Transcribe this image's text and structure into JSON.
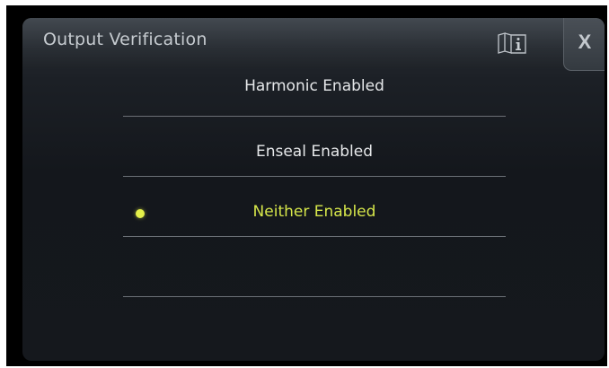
{
  "dialog": {
    "title": "Output Verification",
    "info_icon": "manual-info-icon",
    "close_label": "X"
  },
  "options": [
    {
      "label": "Harmonic Enabled",
      "selected": false
    },
    {
      "label": "Enseal Enabled",
      "selected": false
    },
    {
      "label": "Neither Enabled",
      "selected": true
    },
    {
      "label": "",
      "selected": false
    }
  ],
  "colors": {
    "selected_text": "#d6e64a",
    "selected_dot": "#e4f04a",
    "normal_text": "#e6e8ea"
  }
}
